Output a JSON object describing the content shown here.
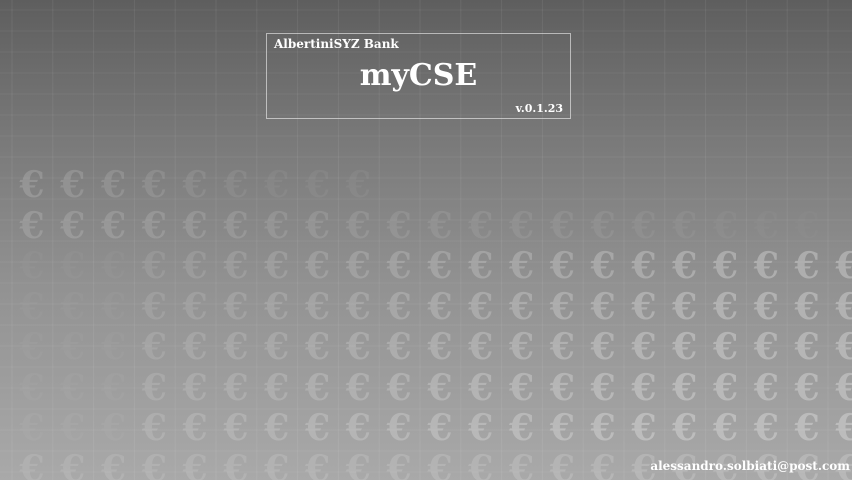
{
  "splash": {
    "company": "AlbertiniSYZ Bank",
    "title": "myCSE",
    "version": "v.0.1.23"
  },
  "footer": {
    "email": "alessandro.solbiati@post.com"
  },
  "background": {
    "pattern_glyph": "€",
    "pattern_icon": "euro-icon",
    "colors": {
      "top": "#5e5e5e",
      "bottom": "#a9a9a9",
      "text": "#ffffff"
    }
  }
}
